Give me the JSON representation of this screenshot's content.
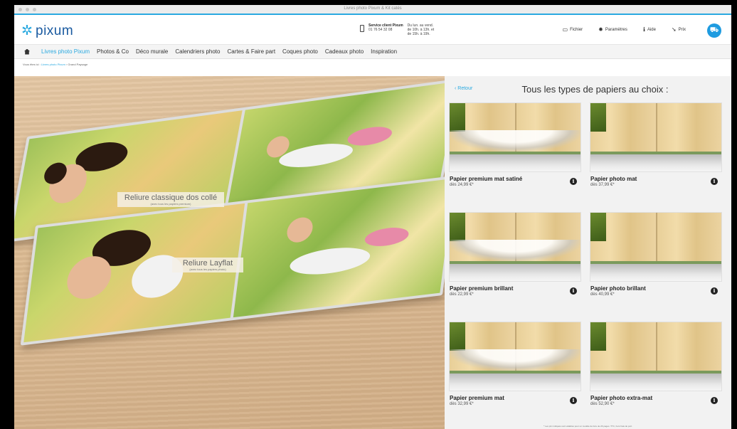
{
  "window": {
    "title": "Livres photo Pixum & Kit catés"
  },
  "brand": {
    "name": "pixum"
  },
  "header": {
    "service_title": "Service client Pixum",
    "service_phone": "01 76 54 32 08",
    "service_hours_1": "Du lun. au vend.",
    "service_hours_2": "de 10h. à 13h. et",
    "service_hours_3": "de 15h. à 19h.",
    "tools": [
      {
        "label": "Fichier",
        "icon": "folder-icon"
      },
      {
        "label": "Paramètres",
        "icon": "gear-icon"
      },
      {
        "label": "Aide",
        "icon": "info-icon"
      },
      {
        "label": "Prix",
        "icon": "tag-icon"
      }
    ]
  },
  "nav": {
    "items": [
      "Livres photo Pixum",
      "Photos & Co",
      "Déco murale",
      "Calendriers photo",
      "Cartes & Faire part",
      "Coques photo",
      "Cadeaux photo",
      "Inspiration"
    ]
  },
  "breadcrumb": {
    "root": "Vous êtes ici :",
    "link": "Livres photo Pixum",
    "current": "Grand Paysage"
  },
  "hero": {
    "caption1_title": "Reliure classique dos collé",
    "caption1_sub": "(avec tous les papiers premium)",
    "caption2_title": "Reliure Layflat",
    "caption2_sub": "(avec tous les papiers photo)"
  },
  "panel": {
    "back_label": "Retour",
    "title": "Tous les types de papiers au choix :",
    "papers": [
      {
        "name": "Papier premium mat satiné",
        "price": "dès 24,99 €*"
      },
      {
        "name": "Papier photo mat",
        "price": "dès 37,99 €*"
      },
      {
        "name": "Papier premium brillant",
        "price": "dès 22,99 €*"
      },
      {
        "name": "Papier photo brillant",
        "price": "dès 40,99 €*"
      },
      {
        "name": "Papier premium mat",
        "price": "dès 32,99 €*"
      },
      {
        "name": "Papier photo extra-mat",
        "price": "dès 52,90 €*"
      }
    ],
    "footnote": "* Les prix indiqués sont valables pour un modèle de livre de 26 pages. TTC, hors frais de port."
  },
  "colors": {
    "accent": "#2aa9e0",
    "brand": "#1a5aa0",
    "cart": "#1e9be0"
  }
}
